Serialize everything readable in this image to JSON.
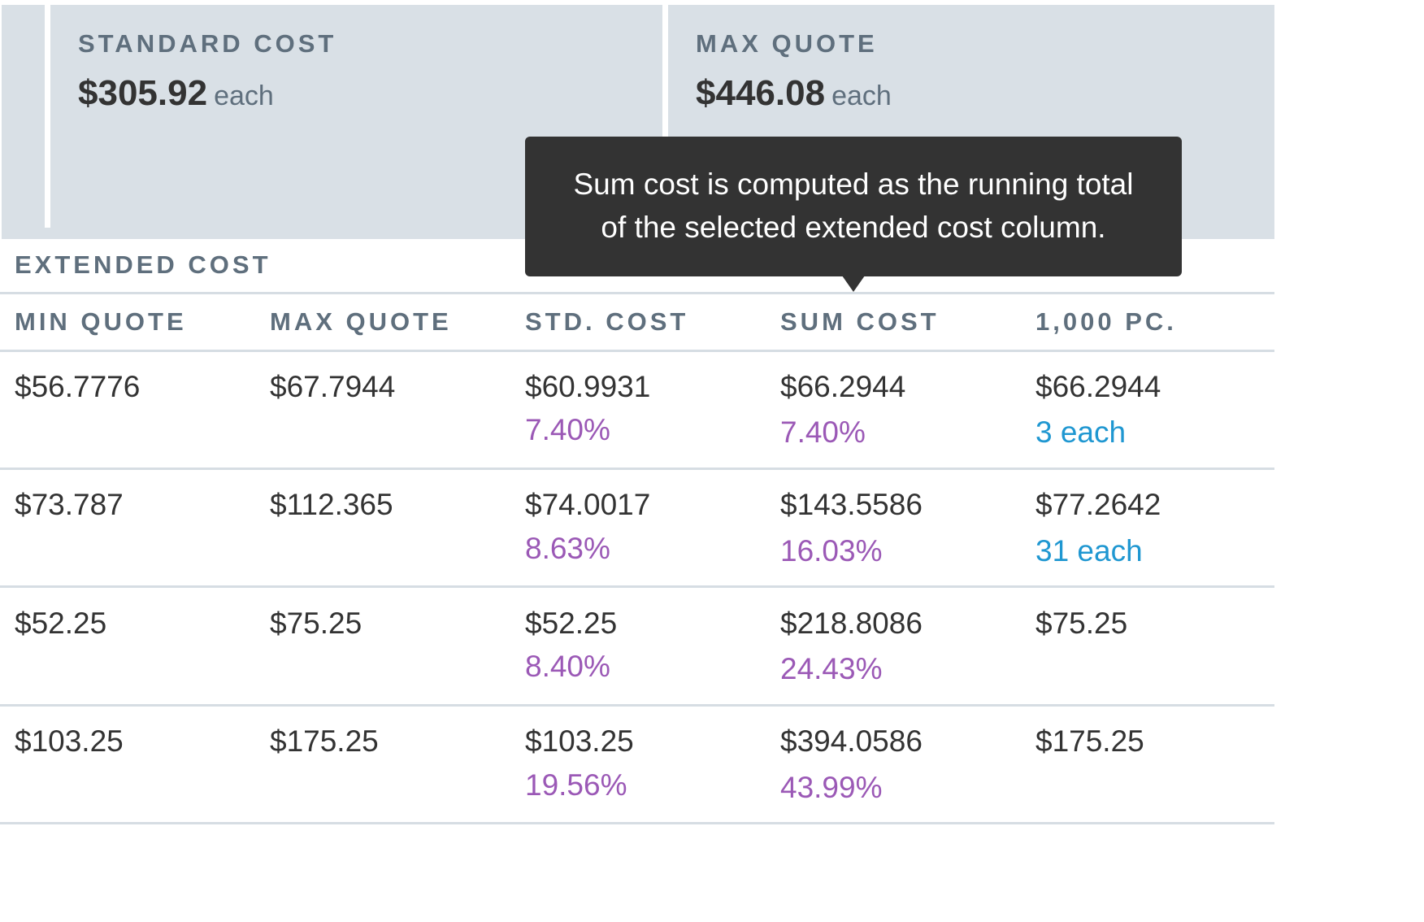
{
  "summary": [
    {
      "label": "STANDARD COST",
      "value": "$305.92",
      "unit": "each"
    },
    {
      "label": "MAX QUOTE",
      "value": "$446.08",
      "unit": "each"
    }
  ],
  "section_title": "EXTENDED COST",
  "columns": [
    "MIN QUOTE",
    "MAX QUOTE",
    "STD. COST",
    "SUM COST",
    "1,000 PC."
  ],
  "rows": [
    {
      "min": "$56.7776",
      "max": "$67.7944",
      "std": "$60.9931",
      "std_pct": "7.40%",
      "sum": "$66.2944",
      "sum_pct": "7.40%",
      "k": "$66.2944",
      "k_qty": "3 each"
    },
    {
      "min": "$73.787",
      "max": "$112.365",
      "std": "$74.0017",
      "std_pct": "8.63%",
      "sum": "$143.5586",
      "sum_pct": "16.03%",
      "k": "$77.2642",
      "k_qty": "31 each"
    },
    {
      "min": "$52.25",
      "max": "$75.25",
      "std": "$52.25",
      "std_pct": "8.40%",
      "sum": "$218.8086",
      "sum_pct": "24.43%",
      "k": "$75.25",
      "k_qty": ""
    },
    {
      "min": "$103.25",
      "max": "$175.25",
      "std": "$103.25",
      "std_pct": "19.56%",
      "sum": "$394.0586",
      "sum_pct": "43.99%",
      "k": "$175.25",
      "k_qty": ""
    }
  ],
  "tooltip": {
    "line1": "Sum cost is computed as the running total",
    "line2": "of the selected extended cost column."
  },
  "colors": {
    "band": "#d9e0e6",
    "label": "#5f6f7d",
    "text": "#333333",
    "percent": "#9b59b6",
    "quantity": "#1f97d1",
    "tooltip_bg": "#333333"
  }
}
